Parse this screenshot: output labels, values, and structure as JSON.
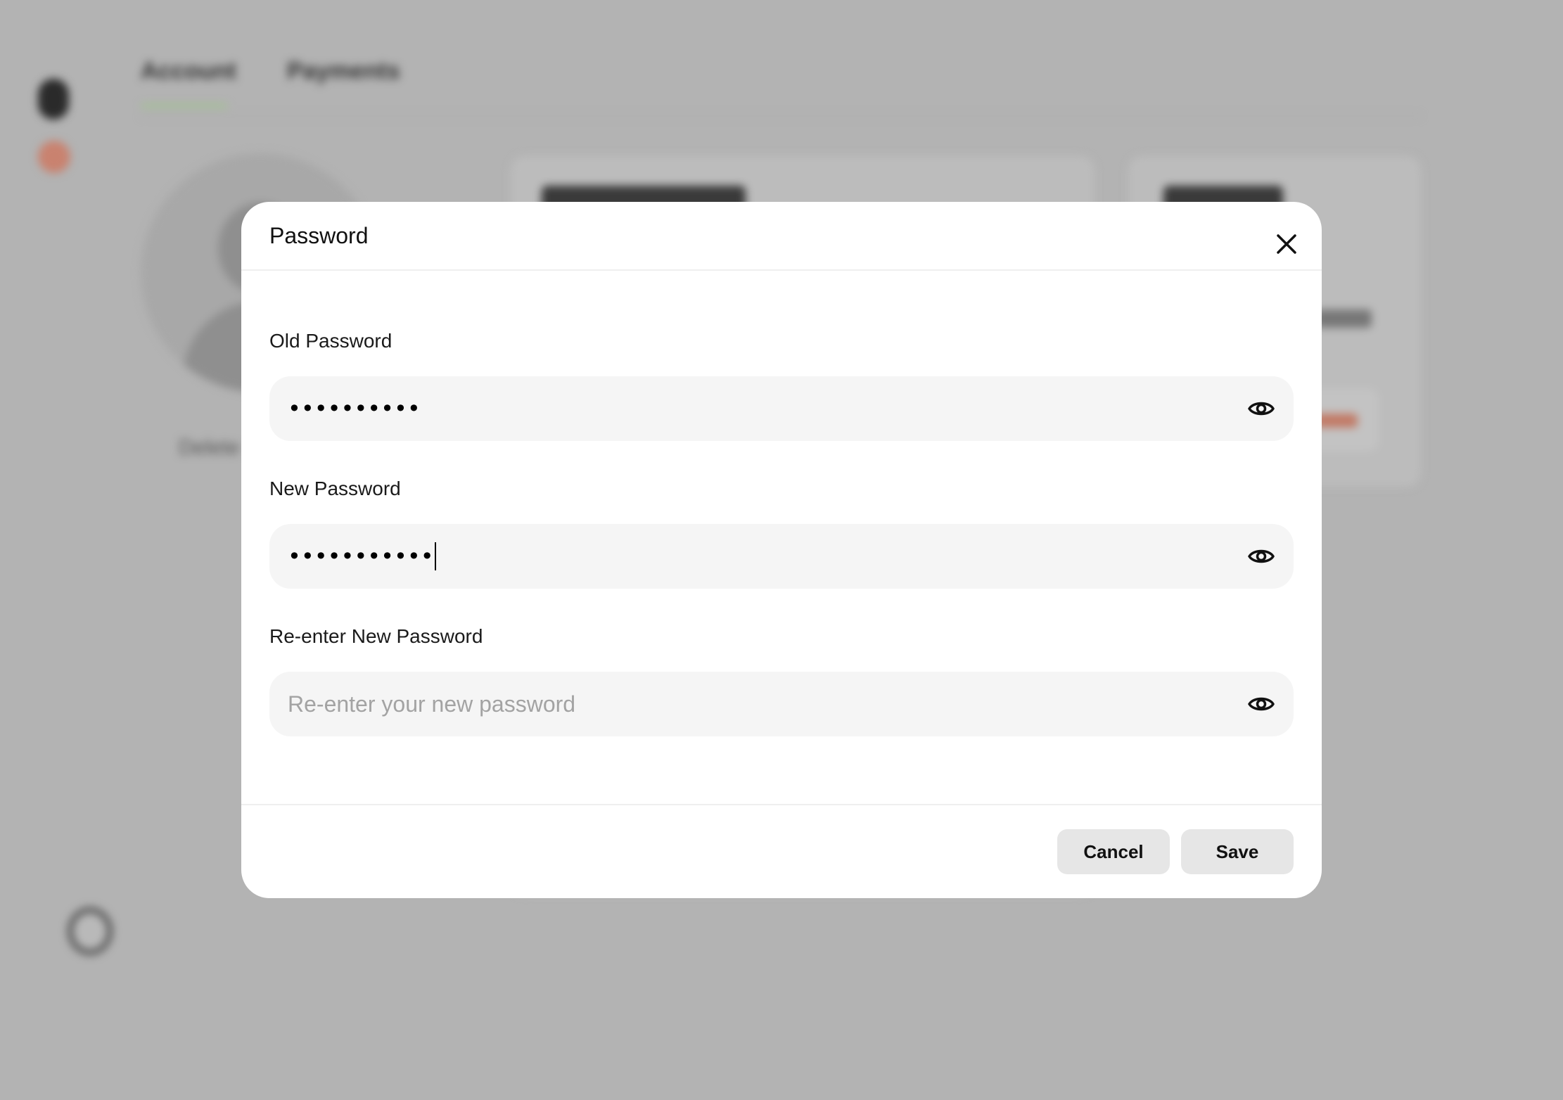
{
  "background": {
    "tabs": [
      "Account",
      "Payments"
    ],
    "avatar_caption": "Delete"
  },
  "modal": {
    "title": "Password",
    "fields": [
      {
        "label": "Old Password",
        "value": "••••••••••",
        "placeholder": ""
      },
      {
        "label": "New Password",
        "value": "•••••••••••",
        "placeholder": ""
      },
      {
        "label": "Re-enter New Password",
        "value": "",
        "placeholder": "Re-enter your new password"
      }
    ],
    "buttons": {
      "cancel": "Cancel",
      "save": "Save"
    }
  },
  "icons": {
    "close": "close-icon",
    "reveal": "eye-icon"
  }
}
